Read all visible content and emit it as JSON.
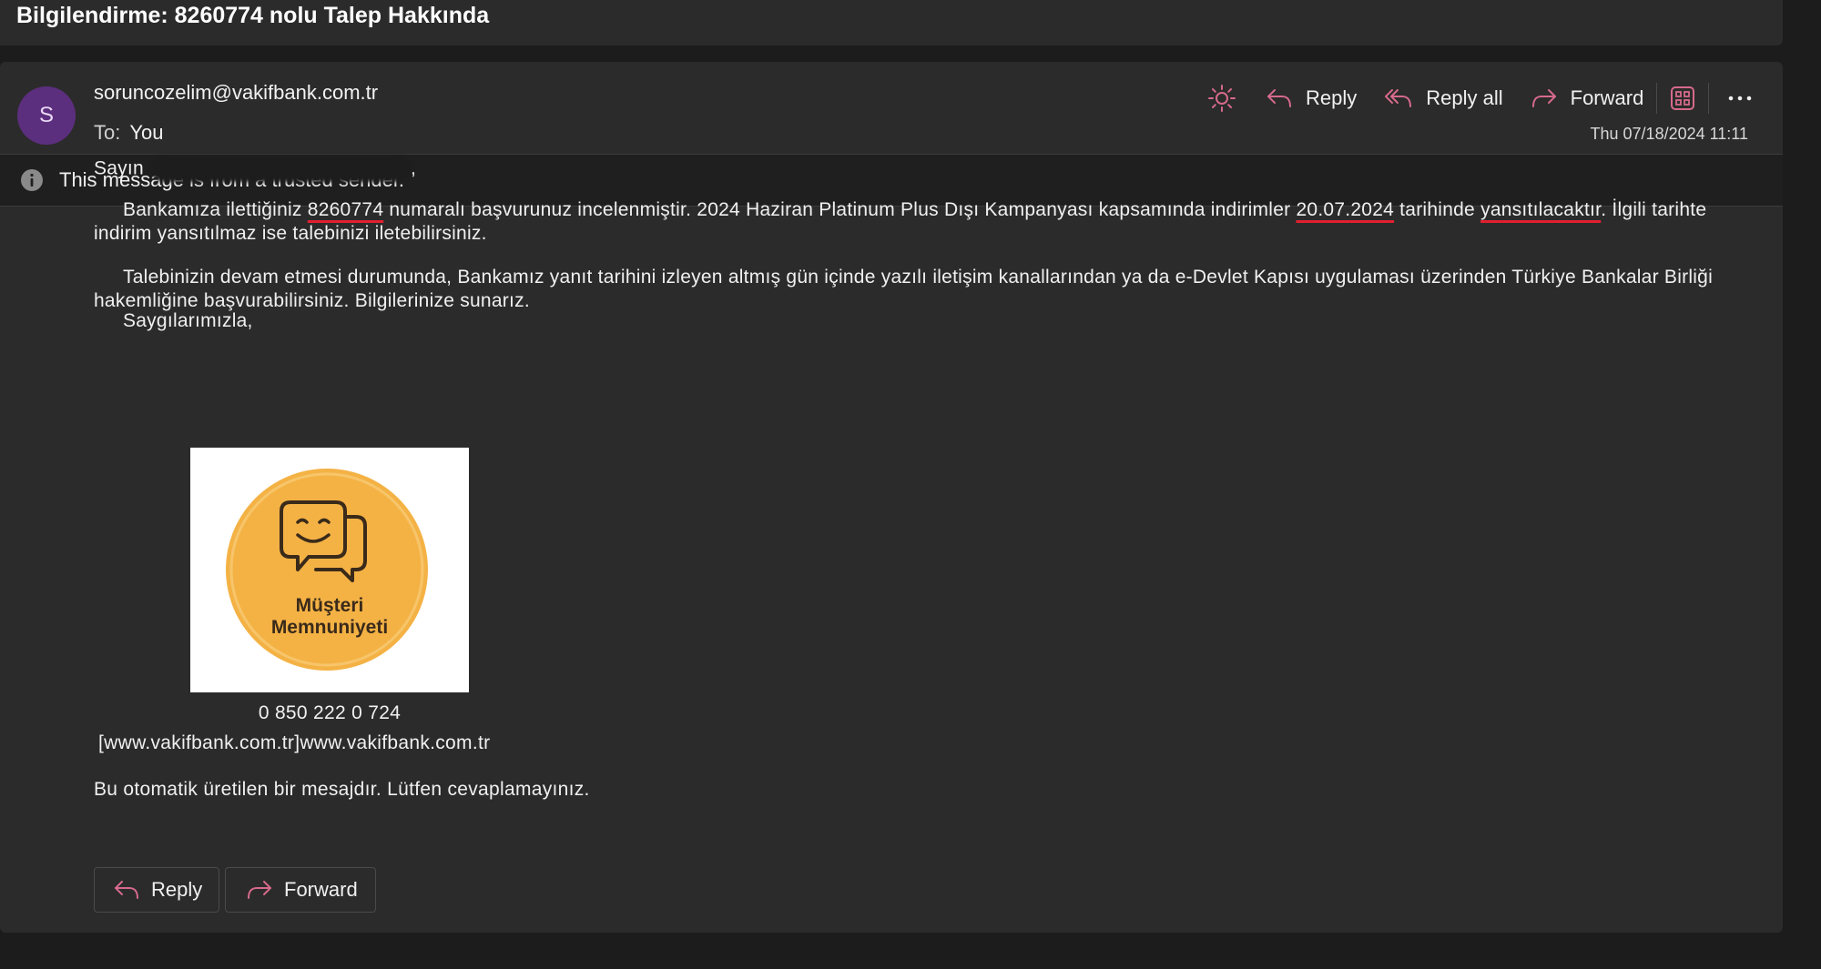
{
  "subject": "Bilgilendirme: 8260774 nolu Talep Hakkında",
  "sender": {
    "avatar_letter": "S",
    "avatar_color": "#5c2e7e",
    "email": "soruncozelim@vakifbank.com.tr",
    "to_label": "To:",
    "to_value": "You"
  },
  "actions": {
    "theme_icon": "sun-icon",
    "reply": "Reply",
    "reply_all": "Reply all",
    "forward": "Forward",
    "apps_icon": "apps-grid-icon",
    "more_icon": "more-options-icon",
    "accent_color": "#d66a8c"
  },
  "date": "Thu 07/18/2024 11:11",
  "banner": {
    "icon": "info-icon",
    "text": "This message is from a trusted sender."
  },
  "body": {
    "greeting": "Sayın",
    "greeting_suffix": ",",
    "p1_a": "Bankamıza ilettiğiniz ",
    "p1_ref": "8260774",
    "p1_b": " numaralı başvurunuz incelenmiştir. 2024 Haziran Platinum Plus Dışı Kampanyası kapsamında indirimler ",
    "p1_date": "20.07.2024",
    "p1_c": " tarihinde ",
    "p1_verb": "yansıtılacaktır",
    "p1_d": ". İlgili tarihte indirim yansıtılmaz ise talebinizi iletebilirsiniz.",
    "p2": "Talebinizin devam etmesi durumunda, Bankamız yanıt tarihini izleyen altmış gün içinde yazılı iletişim kanallarından ya da e-Devlet Kapısı uygulaması üzerinden Türkiye Bankalar Birliği hakemliğine başvurabilirsiniz. Bilgilerinize sunarız.",
    "closing": "Saygılarımızla,"
  },
  "logo": {
    "line1": "Müşteri",
    "line2": "Memnuniyeti",
    "circle_color": "#f4b245"
  },
  "phone": "0 850 222 0 724",
  "website": "[www.vakifbank.com.tr]www.vakifbank.com.tr",
  "auto_note": "Bu otomatik üretilen bir mesajdır. Lütfen cevaplamayınız.",
  "bottom_buttons": {
    "reply": "Reply",
    "forward": "Forward"
  }
}
